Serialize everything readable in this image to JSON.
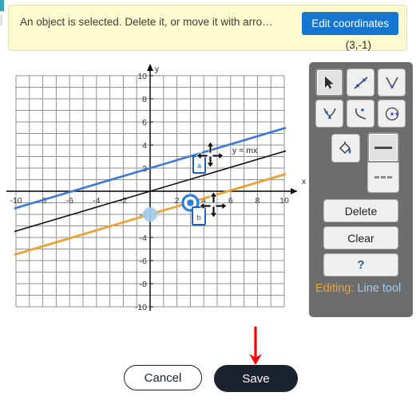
{
  "banner": {
    "message": "An object is selected. Delete it, or move it with arro…",
    "edit_coordinates_label": "Edit coordinates",
    "coordinate_readout": "(3,-1)",
    "background_color": "#fbfbcf",
    "button_color": "#1676cf"
  },
  "graph": {
    "x_axis_label": "x",
    "y_axis_label": "y",
    "x_ticks": [
      "-10",
      "-8",
      "-6",
      "-4",
      "-2",
      "2",
      "4",
      "6",
      "8",
      "10"
    ],
    "y_ticks": [
      "10",
      "8",
      "6",
      "4",
      "2",
      "-2",
      "-4",
      "-6",
      "-8",
      "-10"
    ],
    "annotation": "y = mx",
    "point_label_a": "a",
    "point_label_b": "b",
    "selected_point": "(3,-1)",
    "unselected_point": "(0,-2)",
    "colors": {
      "grid": "#808080",
      "axis": "#000000",
      "blue_line": "#3b78d8",
      "orange_line": "#eba336",
      "black_line": "#111111",
      "point_selected": "#2b7fd4",
      "point_ghost": "#9ecbef",
      "label_box": "#1f5fc0"
    },
    "lines": [
      {
        "name": "blue",
        "slope": 0.35,
        "intercept": 2.0,
        "color": "#3b78d8"
      },
      {
        "name": "black",
        "slope": 0.35,
        "intercept": 0.0,
        "color": "#111111"
      },
      {
        "name": "orange",
        "slope": 0.35,
        "intercept": -2.0,
        "color": "#eba336"
      }
    ]
  },
  "palette": {
    "tools": [
      {
        "name": "select-tool",
        "icon": "cursor-arrow-icon",
        "selected": true
      },
      {
        "name": "line-tool",
        "icon": "line-segment-icon",
        "selected": false
      },
      {
        "name": "absolute-value-tool",
        "icon": "v-shape-icon",
        "selected": false
      },
      {
        "name": "parabola-tool",
        "icon": "parabola-icon",
        "selected": false
      },
      {
        "name": "square-root-tool",
        "icon": "sqrt-curve-icon",
        "selected": false
      },
      {
        "name": "circle-tool",
        "icon": "circle-dot-icon",
        "selected": false
      }
    ],
    "fill_tool": {
      "name": "fill-tool",
      "icon": "paint-bucket-icon"
    },
    "line_styles": [
      {
        "name": "solid-line-style",
        "icon": "solid-line-icon",
        "selected": true
      },
      {
        "name": "dashed-line-style",
        "icon": "dashed-line-icon",
        "selected": false
      }
    ],
    "delete_label": "Delete",
    "clear_label": "Clear",
    "help_label": "?",
    "status_key": "Editing:",
    "status_value": "Line tool",
    "background_color": "#6d6d6d"
  },
  "footer": {
    "cancel_label": "Cancel",
    "save_label": "Save",
    "save_color": "#1b222e",
    "arrow_color": "#ff0000"
  }
}
